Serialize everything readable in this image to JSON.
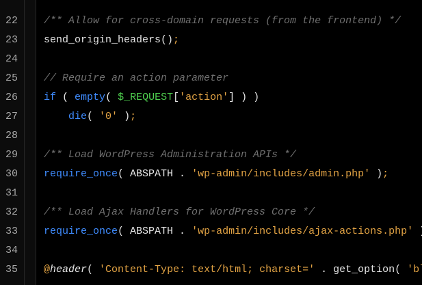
{
  "editor": {
    "lines": [
      {
        "num": "22",
        "segments": [
          {
            "t": "/** Allow for cross-domain requests (from the frontend) */",
            "c": "comment"
          }
        ]
      },
      {
        "num": "23",
        "segments": [
          {
            "t": "send_origin_headers()",
            "c": "plain"
          },
          {
            "t": ";",
            "c": "semi"
          }
        ]
      },
      {
        "num": "24",
        "segments": []
      },
      {
        "num": "25",
        "segments": [
          {
            "t": "// Require an action parameter",
            "c": "comment"
          }
        ]
      },
      {
        "num": "26",
        "segments": [
          {
            "t": "if",
            "c": "kw"
          },
          {
            "t": " ( ",
            "c": "plain"
          },
          {
            "t": "empty",
            "c": "fn"
          },
          {
            "t": "( ",
            "c": "plain"
          },
          {
            "t": "$_REQUEST",
            "c": "var"
          },
          {
            "t": "[",
            "c": "plain"
          },
          {
            "t": "'action'",
            "c": "str"
          },
          {
            "t": "] ) )",
            "c": "plain"
          }
        ]
      },
      {
        "num": "27",
        "segments": [
          {
            "t": "    ",
            "c": "plain"
          },
          {
            "t": "die",
            "c": "fn"
          },
          {
            "t": "( ",
            "c": "plain"
          },
          {
            "t": "'0'",
            "c": "str"
          },
          {
            "t": " )",
            "c": "plain"
          },
          {
            "t": ";",
            "c": "semi"
          }
        ]
      },
      {
        "num": "28",
        "segments": []
      },
      {
        "num": "29",
        "segments": [
          {
            "t": "/** Load WordPress Administration APIs */",
            "c": "comment"
          }
        ]
      },
      {
        "num": "30",
        "segments": [
          {
            "t": "require_once",
            "c": "fn"
          },
          {
            "t": "( ABSPATH . ",
            "c": "plain"
          },
          {
            "t": "'wp-admin/includes/admin.php'",
            "c": "str"
          },
          {
            "t": " )",
            "c": "plain"
          },
          {
            "t": ";",
            "c": "semi"
          }
        ]
      },
      {
        "num": "31",
        "segments": []
      },
      {
        "num": "32",
        "segments": [
          {
            "t": "/** Load Ajax Handlers for WordPress Core */",
            "c": "comment"
          }
        ]
      },
      {
        "num": "33",
        "segments": [
          {
            "t": "require_once",
            "c": "fn"
          },
          {
            "t": "( ABSPATH . ",
            "c": "plain"
          },
          {
            "t": "'wp-admin/includes/ajax-actions.php'",
            "c": "str"
          },
          {
            "t": " )",
            "c": "plain"
          },
          {
            "t": ";",
            "c": "semi"
          }
        ]
      },
      {
        "num": "34",
        "segments": []
      },
      {
        "num": "35",
        "segments": [
          {
            "t": "@",
            "c": "at"
          },
          {
            "t": "header",
            "c": "hdr"
          },
          {
            "t": "( ",
            "c": "plain"
          },
          {
            "t": "'Content-Type: text/html; charset='",
            "c": "str"
          },
          {
            "t": " . get_option( ",
            "c": "plain"
          },
          {
            "t": "'blog_charset'",
            "c": "str"
          },
          {
            "t": " ) )",
            "c": "plain"
          },
          {
            "t": ";",
            "c": "semi"
          }
        ]
      }
    ]
  },
  "colors": {
    "background": "#000000",
    "comment": "#6f6f6f",
    "keyword": "#3f8cff",
    "string": "#e2a344",
    "variable": "#4fd14f",
    "text": "#e6e6e6",
    "line_number": "#a8a8a8"
  }
}
